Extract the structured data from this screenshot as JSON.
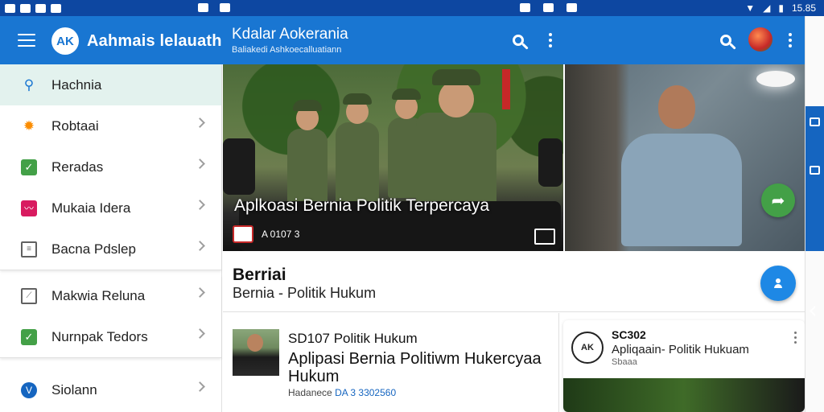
{
  "status_bar": {
    "time": "15.85"
  },
  "app_bar": {
    "logo_text": "AK",
    "app_name": "Aahmais lelauath",
    "title": "Kdalar Aokerania",
    "subtitle": "Baliakedi Ashkoecalluatiann"
  },
  "sidebar": {
    "items": [
      {
        "label": "Hachnia",
        "icon": "search-icon"
      },
      {
        "label": "Robtaai",
        "icon": "sun-icon"
      },
      {
        "label": "Reradas",
        "icon": "check-icon"
      },
      {
        "label": "Mukaia Idera",
        "icon": "pink-chart-icon"
      },
      {
        "label": "Bacna Pdslep",
        "icon": "document-icon"
      },
      {
        "label": "Makwia Reluna",
        "icon": "trend-icon"
      },
      {
        "label": "Nurnpak Tedors",
        "icon": "check-icon"
      },
      {
        "label": "Siolann",
        "icon": "circle-logo-icon"
      }
    ]
  },
  "hero": {
    "caption": "Aplkoasi Bernia Politik Terpercaya",
    "source": "A 0107 3"
  },
  "section": {
    "title": "Berriai",
    "subtitle": "Bernia - Politik Hukum"
  },
  "news_1": {
    "code": "SD107 Politik Hukum",
    "headline": "Aplipasi Bernia Politiwm Hukercyaa Hukum",
    "meta_prefix": "Hadanece",
    "meta_highlight": "DA 3 3302560"
  },
  "news_2": {
    "logo_text": "AK",
    "code": "SC302",
    "headline": "Apliqaain- Politik Hukuam",
    "source": "Sbaaa"
  },
  "colors": {
    "appbar": "#1976d2",
    "statusbar": "#0d47a1",
    "active_item": "#e3f2ee",
    "fab_blue": "#1e88e5",
    "fab_green": "#43a047"
  }
}
